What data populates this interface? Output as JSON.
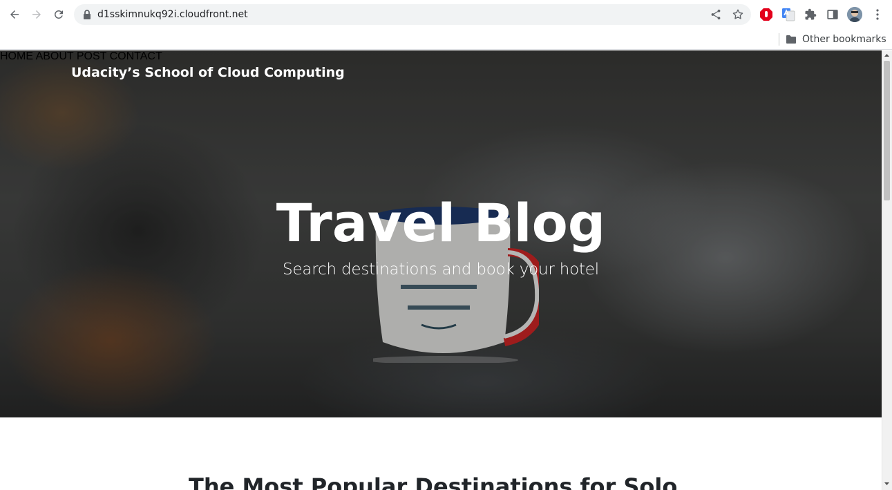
{
  "browser": {
    "url": "d1sskimnukq92i.cloudfront.net",
    "bookmarks": {
      "other_label": "Other bookmarks"
    },
    "icons": [
      "back-arrow-icon",
      "forward-arrow-icon",
      "reload-icon",
      "lock-icon",
      "share-icon",
      "star-icon",
      "adblock-extension-icon",
      "translate-extension-icon",
      "puzzle-icon",
      "side-panel-icon",
      "avatar",
      "kebab-menu-icon",
      "folder-icon"
    ]
  },
  "site": {
    "brand": "Udacity’s School of Cloud Computing",
    "menu": [
      {
        "label": "HOME"
      },
      {
        "label": "ABOUT"
      },
      {
        "label": "POST"
      },
      {
        "label": "CONTACT"
      }
    ],
    "hero": {
      "title": "Travel Blog",
      "subtitle": "Search destinations and book your hotel"
    },
    "section_title": "The Most Popular Destinations for Solo"
  },
  "colors": {
    "text_dark": "#212529",
    "chrome_bg": "#f1f3f4",
    "mug_rim": "#c8102e"
  }
}
